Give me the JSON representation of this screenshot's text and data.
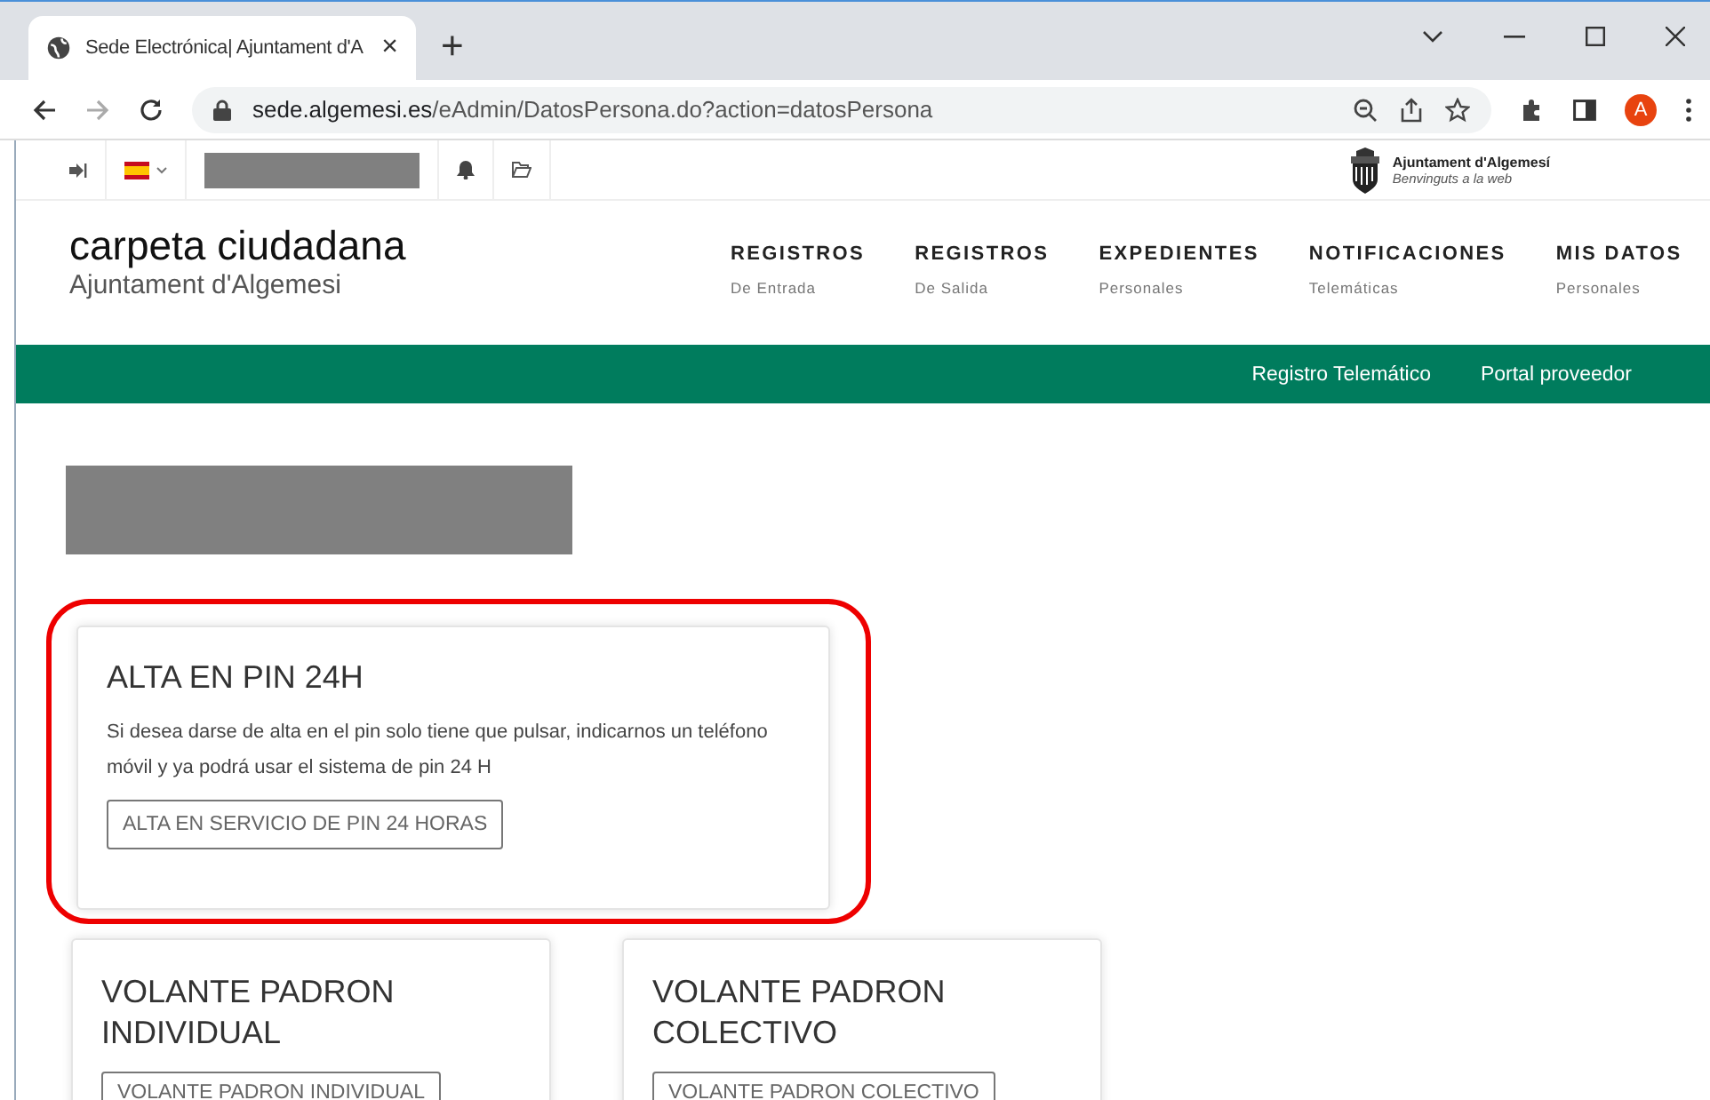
{
  "browser": {
    "tab_title": "Sede Electrónica| Ajuntament d'A",
    "tab_close": "×",
    "new_tab": "+",
    "url_host": "sede.algemesi.es",
    "url_path": "/eAdmin/DatosPersona.do?action=datosPersona",
    "profile": "A"
  },
  "topbar": {
    "org_name": "Ajuntament d'Algemesí",
    "org_tagline": "Benvinguts a la web"
  },
  "header": {
    "title": "carpeta ciudadana",
    "subtitle": "Ajuntament d'Algemesi",
    "nav": [
      {
        "label": "REGISTROS",
        "sub": "De Entrada"
      },
      {
        "label": "REGISTROS",
        "sub": "De Salida"
      },
      {
        "label": "EXPEDIENTES",
        "sub": "Personales"
      },
      {
        "label": "NOTIFICACIONES",
        "sub": "Telemáticas"
      },
      {
        "label": "MIS DATOS",
        "sub": "Personales"
      }
    ]
  },
  "greenbar": {
    "links": [
      "Registro Telemático",
      "Portal proveedor"
    ]
  },
  "cards": [
    {
      "title": "ALTA EN PIN 24H",
      "text": "Si desea darse de alta en el pin solo tiene que pulsar, indicarnos un teléfono móvil y ya podrá usar el sistema de pin 24 H",
      "button": "ALTA EN SERVICIO DE PIN 24 HORAS",
      "highlighted": true
    }
  ],
  "cards_row": [
    {
      "title": "VOLANTE PADRON INDIVIDUAL",
      "button": "VOLANTE PADRON INDIVIDUAL"
    },
    {
      "title": "VOLANTE PADRON COLECTIVO",
      "button": "VOLANTE PADRON COLECTIVO"
    }
  ]
}
